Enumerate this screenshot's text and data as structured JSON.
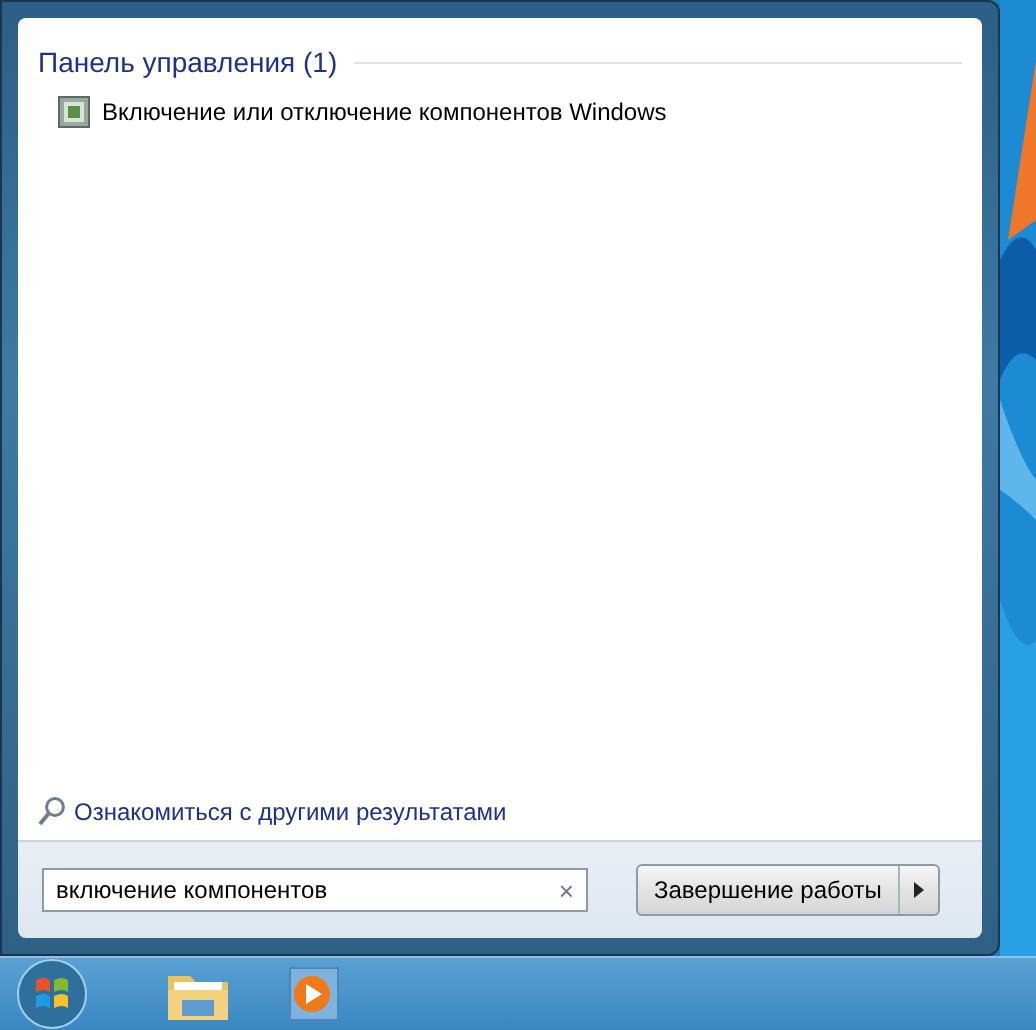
{
  "results": {
    "group_title": "Панель управления (1)",
    "items": [
      {
        "label": "Включение или отключение компонентов Windows"
      }
    ]
  },
  "more_results_link": "Ознакомиться с другими результатами",
  "search": {
    "value": "включение компонентов",
    "clear": "×"
  },
  "shutdown_button": {
    "label": "Завершение работы"
  },
  "taskbar": {
    "items": [
      {
        "kind": "start"
      },
      {
        "kind": "explorer"
      },
      {
        "kind": "media_player"
      }
    ]
  }
}
